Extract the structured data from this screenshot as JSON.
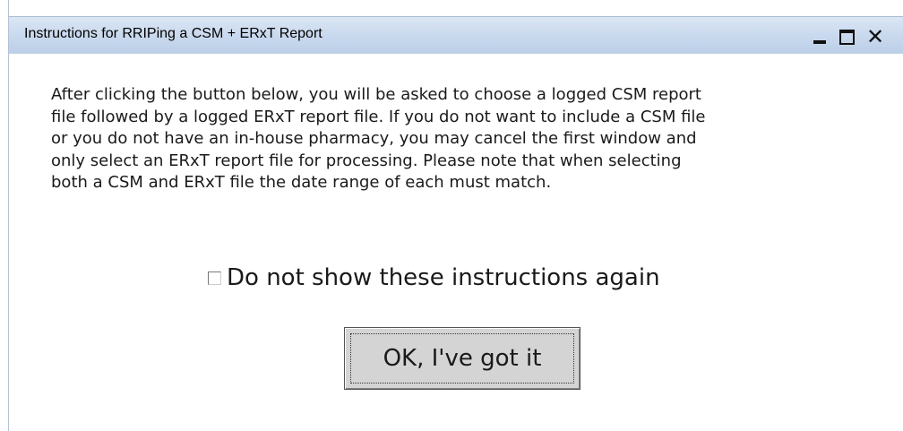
{
  "window": {
    "title": "Instructions for RRIPing a CSM + ERxT Report",
    "controls": {
      "minimize": "_",
      "maximize": "□",
      "close": "✕"
    }
  },
  "instructions": {
    "lines": [
      "After clicking the button below, you will be asked to choose a logged CSM report",
      "file followed by a logged ERxT report file.  If you do not want to include a CSM file",
      "or you do not have an in-house pharmacy, you may cancel the first window and",
      "only select an ERxT report file for processing.  Please note that when selecting",
      "both a CSM and ERxT file the date range of each must match."
    ]
  },
  "checkbox": {
    "label": "Do not show these instructions again",
    "checked": false
  },
  "ok_button": {
    "label": "OK, I've got it"
  }
}
